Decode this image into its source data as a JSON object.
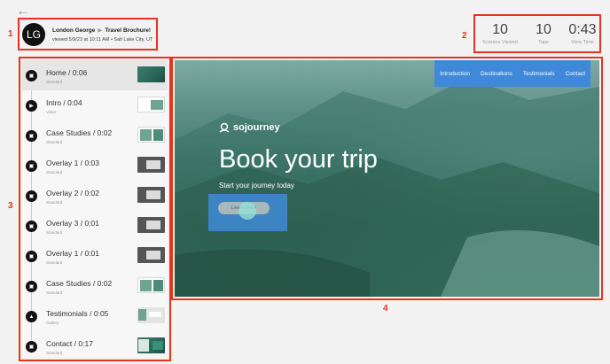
{
  "header": {
    "avatar_initials": "LG",
    "user_name": "London George",
    "separator": "▶",
    "presentation": "Travel Brochure!",
    "viewed_info": "viewed 5/9/23 at 10:11 AM • Salt Lake City, UT"
  },
  "stats": [
    {
      "value": "10",
      "label": "Screens Viewed"
    },
    {
      "value": "10",
      "label": "Taps"
    },
    {
      "value": "0:43",
      "label": "View Time"
    }
  ],
  "markers": [
    "1",
    "2",
    "3",
    "4"
  ],
  "sidebar": {
    "items": [
      {
        "title": "Home / 0:06",
        "type": "Standard",
        "icon": "screen-icon"
      },
      {
        "title": "Intro / 0:04",
        "type": "Video",
        "icon": "play-icon"
      },
      {
        "title": "Case Studies / 0:02",
        "type": "Standard",
        "icon": "screen-icon"
      },
      {
        "title": "Overlay 1 / 0:03",
        "type": "Standard",
        "icon": "screen-icon"
      },
      {
        "title": "Overlay 2 / 0:02",
        "type": "Standard",
        "icon": "screen-icon"
      },
      {
        "title": "Overlay 3 / 0:01",
        "type": "Standard",
        "icon": "screen-icon"
      },
      {
        "title": "Overlay 1 / 0:01",
        "type": "Standard",
        "icon": "screen-icon"
      },
      {
        "title": "Case Studies / 0:02",
        "type": "Standard",
        "icon": "screen-icon"
      },
      {
        "title": "Testimonials / 0:05",
        "type": "Gallery",
        "icon": "gallery-icon"
      },
      {
        "title": "Contact / 0:17",
        "type": "Standard",
        "icon": "screen-icon"
      }
    ]
  },
  "preview": {
    "nav": [
      "Introduction",
      "Destinations",
      "Testimonials",
      "Contact"
    ],
    "brand": "sojourney",
    "headline": "Book your trip",
    "subheadline": "Start your journey today",
    "cta": "Learn More"
  },
  "colors": {
    "annotation": "#e8341c",
    "highlight": "#3f89d8",
    "tap": "#96e1d7"
  }
}
